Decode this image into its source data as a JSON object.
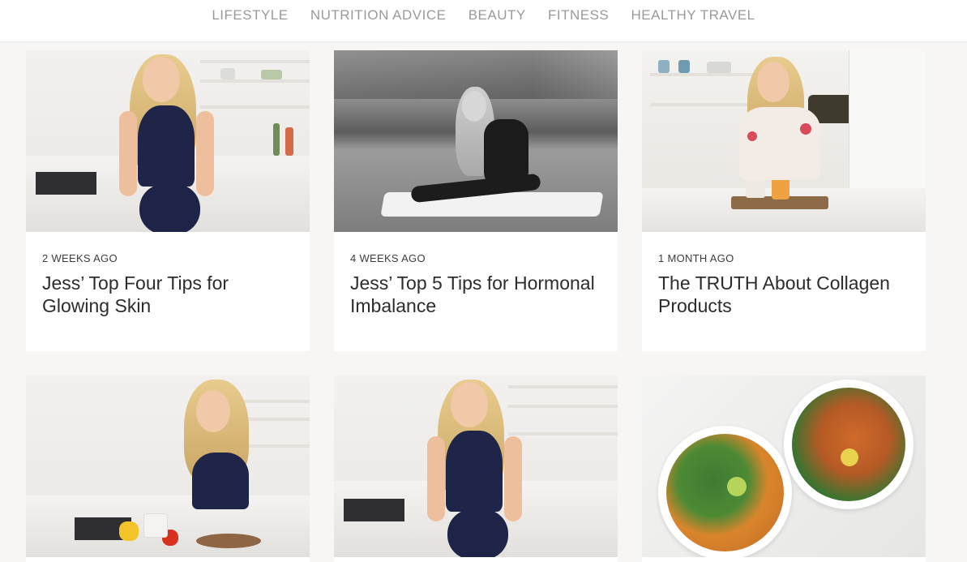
{
  "nav": {
    "items": [
      "LIFESTYLE",
      "NUTRITION ADVICE",
      "BEAUTY",
      "FITNESS",
      "HEALTHY TRAVEL"
    ]
  },
  "cards": [
    {
      "date": "2 WEEKS AGO",
      "title": "Jess’ Top Four Tips for Glowing Skin",
      "image": "woman-kitchen-photo"
    },
    {
      "date": "4 WEEKS AGO",
      "title": "Jess’ Top 5 Tips for Hormonal Imbalance",
      "image": "woman-stretching-bw-photo"
    },
    {
      "date": "1 MONTH AGO",
      "title": "The TRUTH About Collagen Products",
      "image": "woman-collagen-photo"
    },
    {
      "date": "",
      "title": "",
      "image": "woman-chopping-peppers-photo"
    },
    {
      "date": "",
      "title": "",
      "image": "woman-kitchen-photo"
    },
    {
      "date": "",
      "title": "",
      "image": "food-bowls-photo"
    }
  ],
  "colors": {
    "background": "#f7f6f4",
    "nav_text": "#9a9a9a",
    "card_bg": "#ffffff",
    "title_text": "#2c2c2c"
  }
}
